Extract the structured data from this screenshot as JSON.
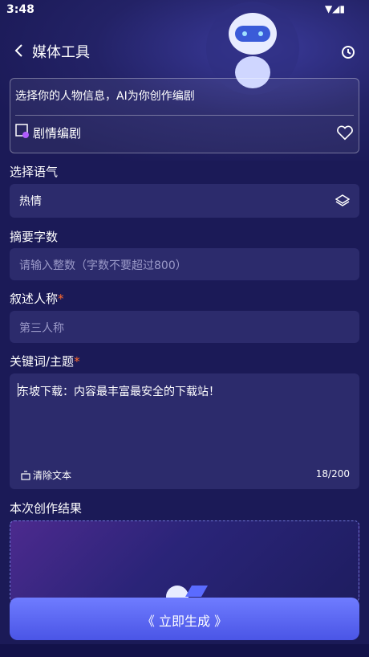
{
  "status": {
    "time": "3:48"
  },
  "header": {
    "title": "媒体工具"
  },
  "card": {
    "prompt": "选择你的人物信息，AI为你创作编剧",
    "drama_label": "剧情编剧"
  },
  "tone": {
    "label": "选择语气",
    "value": "热情"
  },
  "summary": {
    "label": "摘要字数",
    "placeholder": "请输入整数（字数不要超过800）"
  },
  "narrative": {
    "label": "叙述人称",
    "required": "*",
    "placeholder": "第三人称"
  },
  "keywords": {
    "label": "关键词/主题",
    "required": "*",
    "value": "东坡下载：内容最丰富最安全的下载站！",
    "clear_label": "清除文本",
    "count": "18/200"
  },
  "result": {
    "label": "本次创作结果"
  },
  "generate": {
    "label": "《 立即生成 》"
  }
}
